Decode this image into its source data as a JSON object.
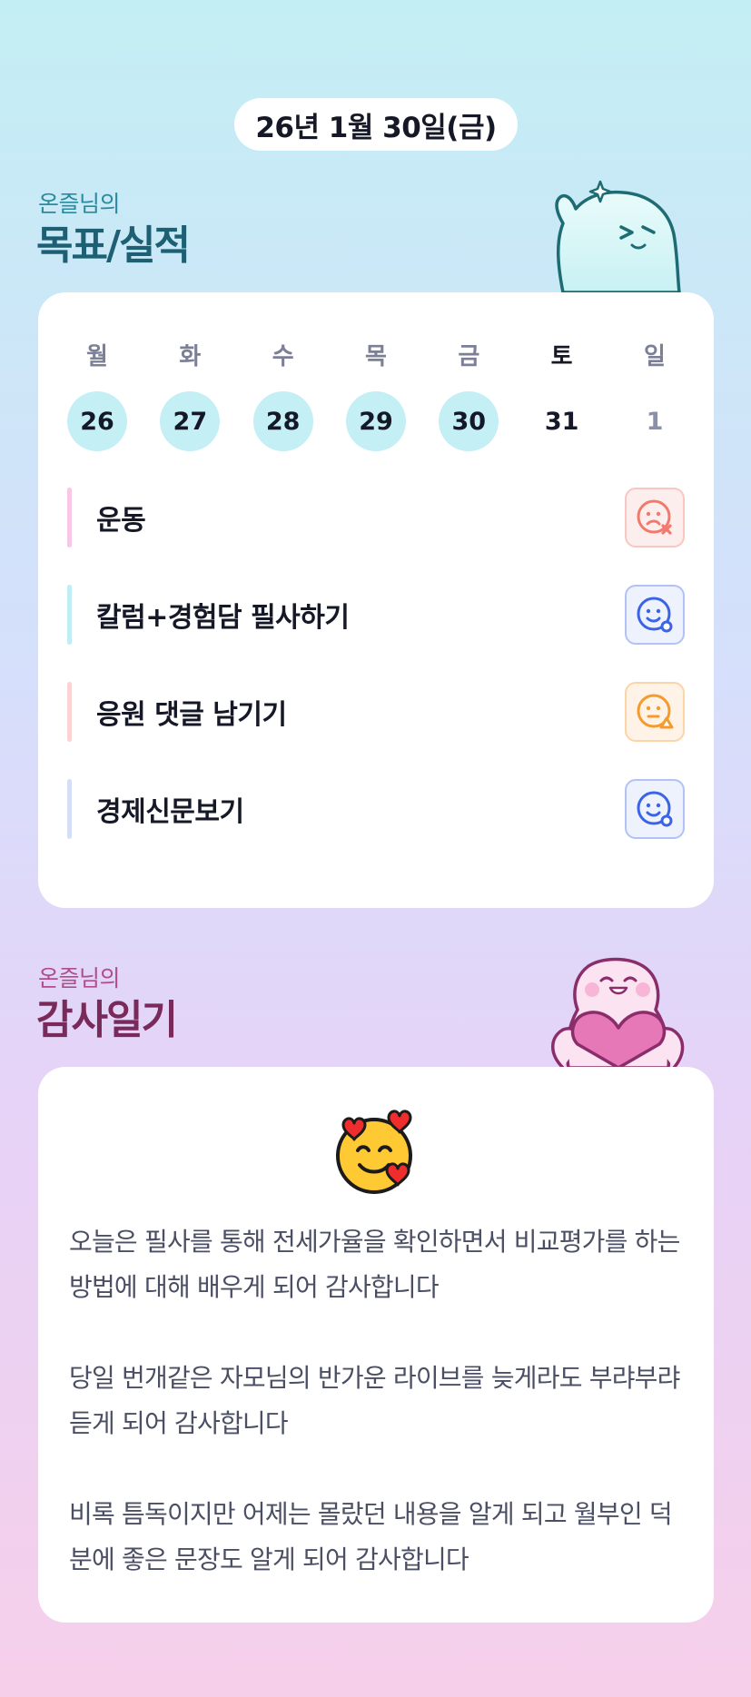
{
  "date": "26년 1월 30일(금)",
  "goals_section": {
    "subtitle": "온즐님의",
    "title": "목표/실적"
  },
  "week": {
    "weekdays": [
      "월",
      "화",
      "수",
      "목",
      "금",
      "토",
      "일"
    ],
    "days": [
      {
        "num": "26",
        "state": "done"
      },
      {
        "num": "27",
        "state": "done"
      },
      {
        "num": "28",
        "state": "done"
      },
      {
        "num": "29",
        "state": "done"
      },
      {
        "num": "30",
        "state": "done"
      },
      {
        "num": "31",
        "state": "current"
      },
      {
        "num": "1",
        "state": "future"
      }
    ]
  },
  "tasks": [
    {
      "label": "운동",
      "bar_color": "#f8c6e6",
      "status": "sad-x-face-icon",
      "status_color": "#f27a6c",
      "status_bg": "#fdeeee"
    },
    {
      "label": "칼럼+경험담 필사하기",
      "bar_color": "#bfeef4",
      "status": "smile-circle-face-icon",
      "status_color": "#3b63e8",
      "status_bg": "#eef2fd"
    },
    {
      "label": "응원 댓글 남기기",
      "bar_color": "#fbd3d3",
      "status": "meh-triangle-face-icon",
      "status_color": "#f59a2c",
      "status_bg": "#fef3e6"
    },
    {
      "label": "경제신문보기",
      "bar_color": "#d5def8",
      "status": "smile-circle-face-icon",
      "status_color": "#3b63e8",
      "status_bg": "#eef2fd"
    }
  ],
  "thanks_section": {
    "subtitle": "온즐님의",
    "title": "감사일기"
  },
  "diary_emoji": "smiling-face-with-hearts-icon",
  "diary_entries": [
    "오늘은 필사를 통해 전세가율을 확인하면서 비교평가를 하는 방법에 대해 배우게 되어 감사합니다",
    "당일 번개같은 자모님의 반가운 라이브를 늦게라도 부랴부랴 듣게 되어 감사합니다",
    "비록 틈독이지만 어제는 몰랐던 내용을 알게 되고 월부인 덕분에 좋은 문장도 알게 되어 감사합니다"
  ]
}
